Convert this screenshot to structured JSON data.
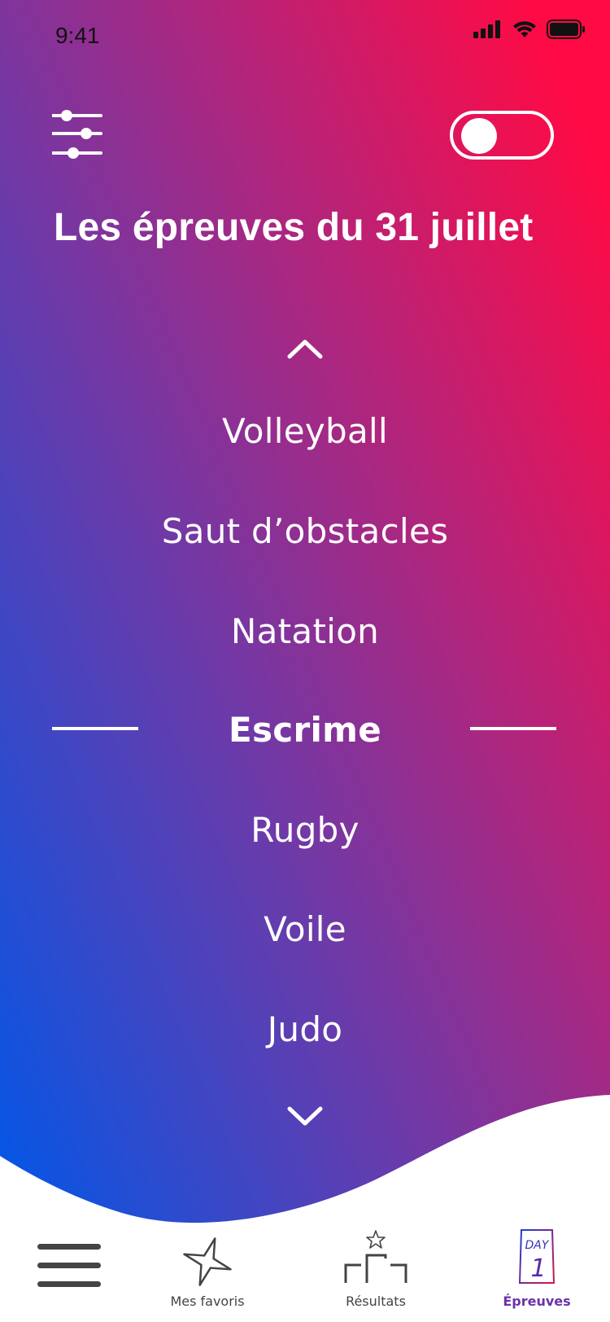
{
  "status_bar": {
    "time": "9:41"
  },
  "header": {
    "filter_icon": "sliders-icon",
    "toggle_state": "off",
    "title": "Les épreuves du 31 juillet"
  },
  "picker": {
    "items": [
      "Volleyball",
      "Saut d’obstacles",
      "Natation",
      "Escrime",
      "Rugby",
      "Voile",
      "Judo"
    ],
    "selected_index": 3,
    "up_icon": "chevron-up-icon",
    "down_icon": "chevron-down-icon"
  },
  "tabbar": {
    "menu_icon": "hamburger-icon",
    "tabs": [
      {
        "label": "Mes favoris",
        "icon": "star-icon"
      },
      {
        "label": "Résultats",
        "icon": "podium-icon"
      },
      {
        "label": "Épreuves",
        "icon": "day-calendar-icon",
        "icon_text": [
          "DAY",
          "1"
        ]
      }
    ],
    "active_tab": 2
  },
  "colors": {
    "gradient_left": "#0057e8",
    "gradient_mid": "#6e3ba8",
    "gradient_right": "#ff0a44",
    "active_tab": "#6a33a8",
    "inactive_tab": "#444444"
  }
}
